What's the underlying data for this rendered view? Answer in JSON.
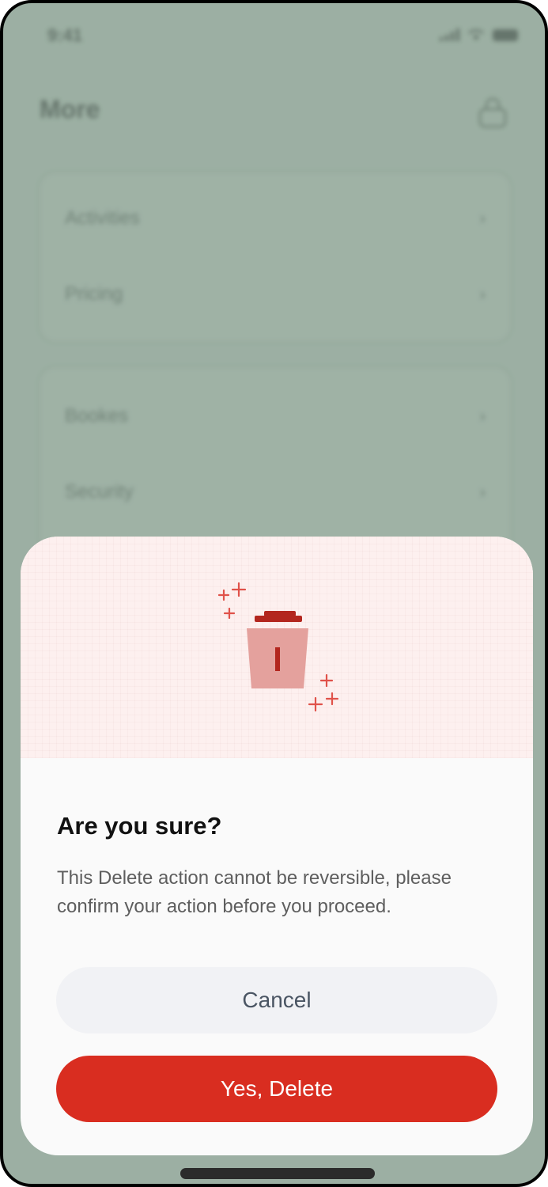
{
  "status_bar": {
    "time": "9:41"
  },
  "background": {
    "title": "More",
    "groups": [
      {
        "items": [
          {
            "label": "Activities"
          },
          {
            "label": "Pricing"
          }
        ]
      },
      {
        "items": [
          {
            "label": "Bookes"
          },
          {
            "label": "Security"
          }
        ]
      }
    ]
  },
  "dialog": {
    "title": "Are you sure?",
    "message": "This Delete action cannot be reversible, please confirm your action before you proceed.",
    "cancel_label": "Cancel",
    "confirm_label": "Yes, Delete",
    "accent_color": "#d92d20",
    "hero_color": "#fdf0ef"
  },
  "icons": {
    "illustration": "trash-can-icon",
    "chevron": "chevron-right-icon",
    "header": "lock-icon"
  }
}
